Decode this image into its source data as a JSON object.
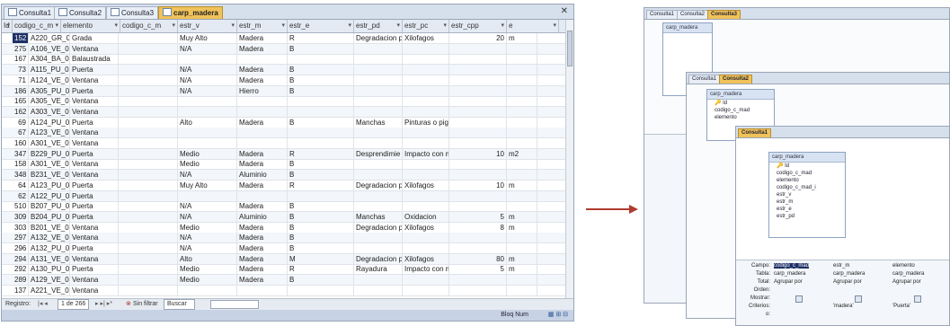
{
  "left": {
    "tabs": [
      {
        "label": "Consulta1",
        "active": false
      },
      {
        "label": "Consulta2",
        "active": false
      },
      {
        "label": "Consulta3",
        "active": false
      },
      {
        "label": "carp_madera",
        "active": true
      }
    ],
    "columns": [
      "Id",
      "codigo_c_m",
      "elemento",
      "codigo_c_m",
      "estr_v",
      "estr_m",
      "estr_e",
      "estr_pd",
      "estr_pc",
      "estr_cpp",
      "e"
    ],
    "rows": [
      [
        "152",
        "A220_GR_01",
        "Grada",
        "",
        "Muy Alto",
        "Madera",
        "R",
        "Degradacion p",
        "Xilofagos",
        "20",
        "m"
      ],
      [
        "275",
        "A106_VE_01",
        "Ventana",
        "",
        "N/A",
        "Madera",
        "B",
        "",
        "",
        "",
        ""
      ],
      [
        "167",
        "A304_BA_01",
        "Balaustrada",
        "",
        "",
        "",
        "",
        "",
        "",
        "",
        ""
      ],
      [
        "73",
        "A115_PU_01",
        "Puerta",
        "",
        "N/A",
        "Madera",
        "B",
        "",
        "",
        "",
        ""
      ],
      [
        "71",
        "A124_VE_01",
        "Ventana",
        "",
        "N/A",
        "Madera",
        "B",
        "",
        "",
        "",
        ""
      ],
      [
        "186",
        "A305_PU_01",
        "Puerta",
        "",
        "N/A",
        "Hierro",
        "B",
        "",
        "",
        "",
        ""
      ],
      [
        "165",
        "A305_VE_03",
        "Ventana",
        "",
        "",
        "",
        "",
        "",
        "",
        "",
        ""
      ],
      [
        "162",
        "A303_VE_02",
        "Ventana",
        "",
        "",
        "",
        "",
        "",
        "",
        "",
        ""
      ],
      [
        "69",
        "A124_PU_02",
        "Puerta",
        "",
        "Alto",
        "Madera",
        "B",
        "Manchas",
        "Pinturas o pigr",
        "",
        ""
      ],
      [
        "67",
        "A123_VE_03",
        "Ventana",
        "",
        "",
        "",
        "",
        "",
        "",
        "",
        ""
      ],
      [
        "160",
        "A301_VE_03",
        "Ventana",
        "",
        "",
        "",
        "",
        "",
        "",
        "",
        ""
      ],
      [
        "347",
        "B229_PU_04",
        "Puerta",
        "",
        "Medio",
        "Madera",
        "R",
        "Desprendimie",
        "Impacto con m",
        "10",
        "m2"
      ],
      [
        "158",
        "A301_VE_01",
        "Ventana",
        "",
        "Medio",
        "Madera",
        "B",
        "",
        "",
        "",
        ""
      ],
      [
        "348",
        "B231_VE_01",
        "Ventana",
        "",
        "N/A",
        "Aluminio",
        "B",
        "",
        "",
        "",
        ""
      ],
      [
        "64",
        "A123_PU_02",
        "Puerta",
        "",
        "Muy Alto",
        "Madera",
        "R",
        "Degradacion p",
        "Xilofagos",
        "10",
        "m"
      ],
      [
        "62",
        "A122_PU_01",
        "Puerta",
        "",
        "",
        "",
        "",
        "",
        "",
        "",
        ""
      ],
      [
        "510",
        "B207_PU_01",
        "Puerta",
        "",
        "N/A",
        "Madera",
        "B",
        "",
        "",
        "",
        ""
      ],
      [
        "309",
        "B204_PU_01",
        "Puerta",
        "",
        "N/A",
        "Aluminio",
        "B",
        "Manchas",
        "Oxidacion",
        "5",
        "m"
      ],
      [
        "303",
        "B201_VE_01",
        "Ventana",
        "",
        "Medio",
        "Madera",
        "B",
        "Degradacion p",
        "Xilofagos",
        "8",
        "m"
      ],
      [
        "297",
        "A132_VE_01",
        "Ventana",
        "",
        "N/A",
        "Madera",
        "B",
        "",
        "",
        "",
        ""
      ],
      [
        "296",
        "A132_PU_02",
        "Puerta",
        "",
        "N/A",
        "Madera",
        "B",
        "",
        "",
        "",
        ""
      ],
      [
        "294",
        "A131_VE_01",
        "Ventana",
        "",
        "Alto",
        "Madera",
        "M",
        "Degradacion p",
        "Xilofagos",
        "80",
        "m"
      ],
      [
        "292",
        "A130_PU_02",
        "Puerta",
        "",
        "Medio",
        "Madera",
        "R",
        "Rayadura",
        "Impacto con m",
        "5",
        "m"
      ],
      [
        "289",
        "A129_VE_01",
        "Ventana",
        "",
        "Medio",
        "Madera",
        "B",
        "",
        "",
        "",
        ""
      ],
      [
        "137",
        "A221_VE_01",
        "Ventana",
        "",
        "",
        "",
        "",
        "",
        "",
        "",
        ""
      ]
    ],
    "nav": {
      "registro": "Registro:",
      "position": "1 de 266",
      "filter": "Sin filtrar",
      "search": "Buscar"
    },
    "status": "Bloq Num"
  },
  "right": {
    "tabs_a": [
      "Consulta1",
      "Consulta2",
      "Consulta3"
    ],
    "tabs_b": [
      "Consulta1",
      "Consulta2"
    ],
    "tabs_c": [
      "Consulta1"
    ],
    "table_name": "carp_madera",
    "fields": [
      "Id",
      "codigo_c_mad",
      "elemento",
      "codigo_c_mad_i",
      "estr_v",
      "estr_m",
      "estr_e",
      "estr_pd"
    ],
    "fields_mid": [
      "Id",
      "codigo_c_mad",
      "elemento"
    ],
    "grid_labels": [
      "Campo:",
      "Tabla:",
      "Total:",
      "Orden:",
      "Mostrar:",
      "Criterios:",
      "o:"
    ],
    "grid_cols": [
      {
        "campo": "codigo_c_mad",
        "tabla": "carp_madera",
        "total": "Agrupar por",
        "criterios": ""
      },
      {
        "campo": "estr_m",
        "tabla": "carp_madera",
        "total": "Agrupar por",
        "criterios": "'madera'"
      },
      {
        "campo": "elemento",
        "tabla": "carp_madera",
        "total": "Agrupar por",
        "criterios": "'Puerta'"
      }
    ]
  }
}
